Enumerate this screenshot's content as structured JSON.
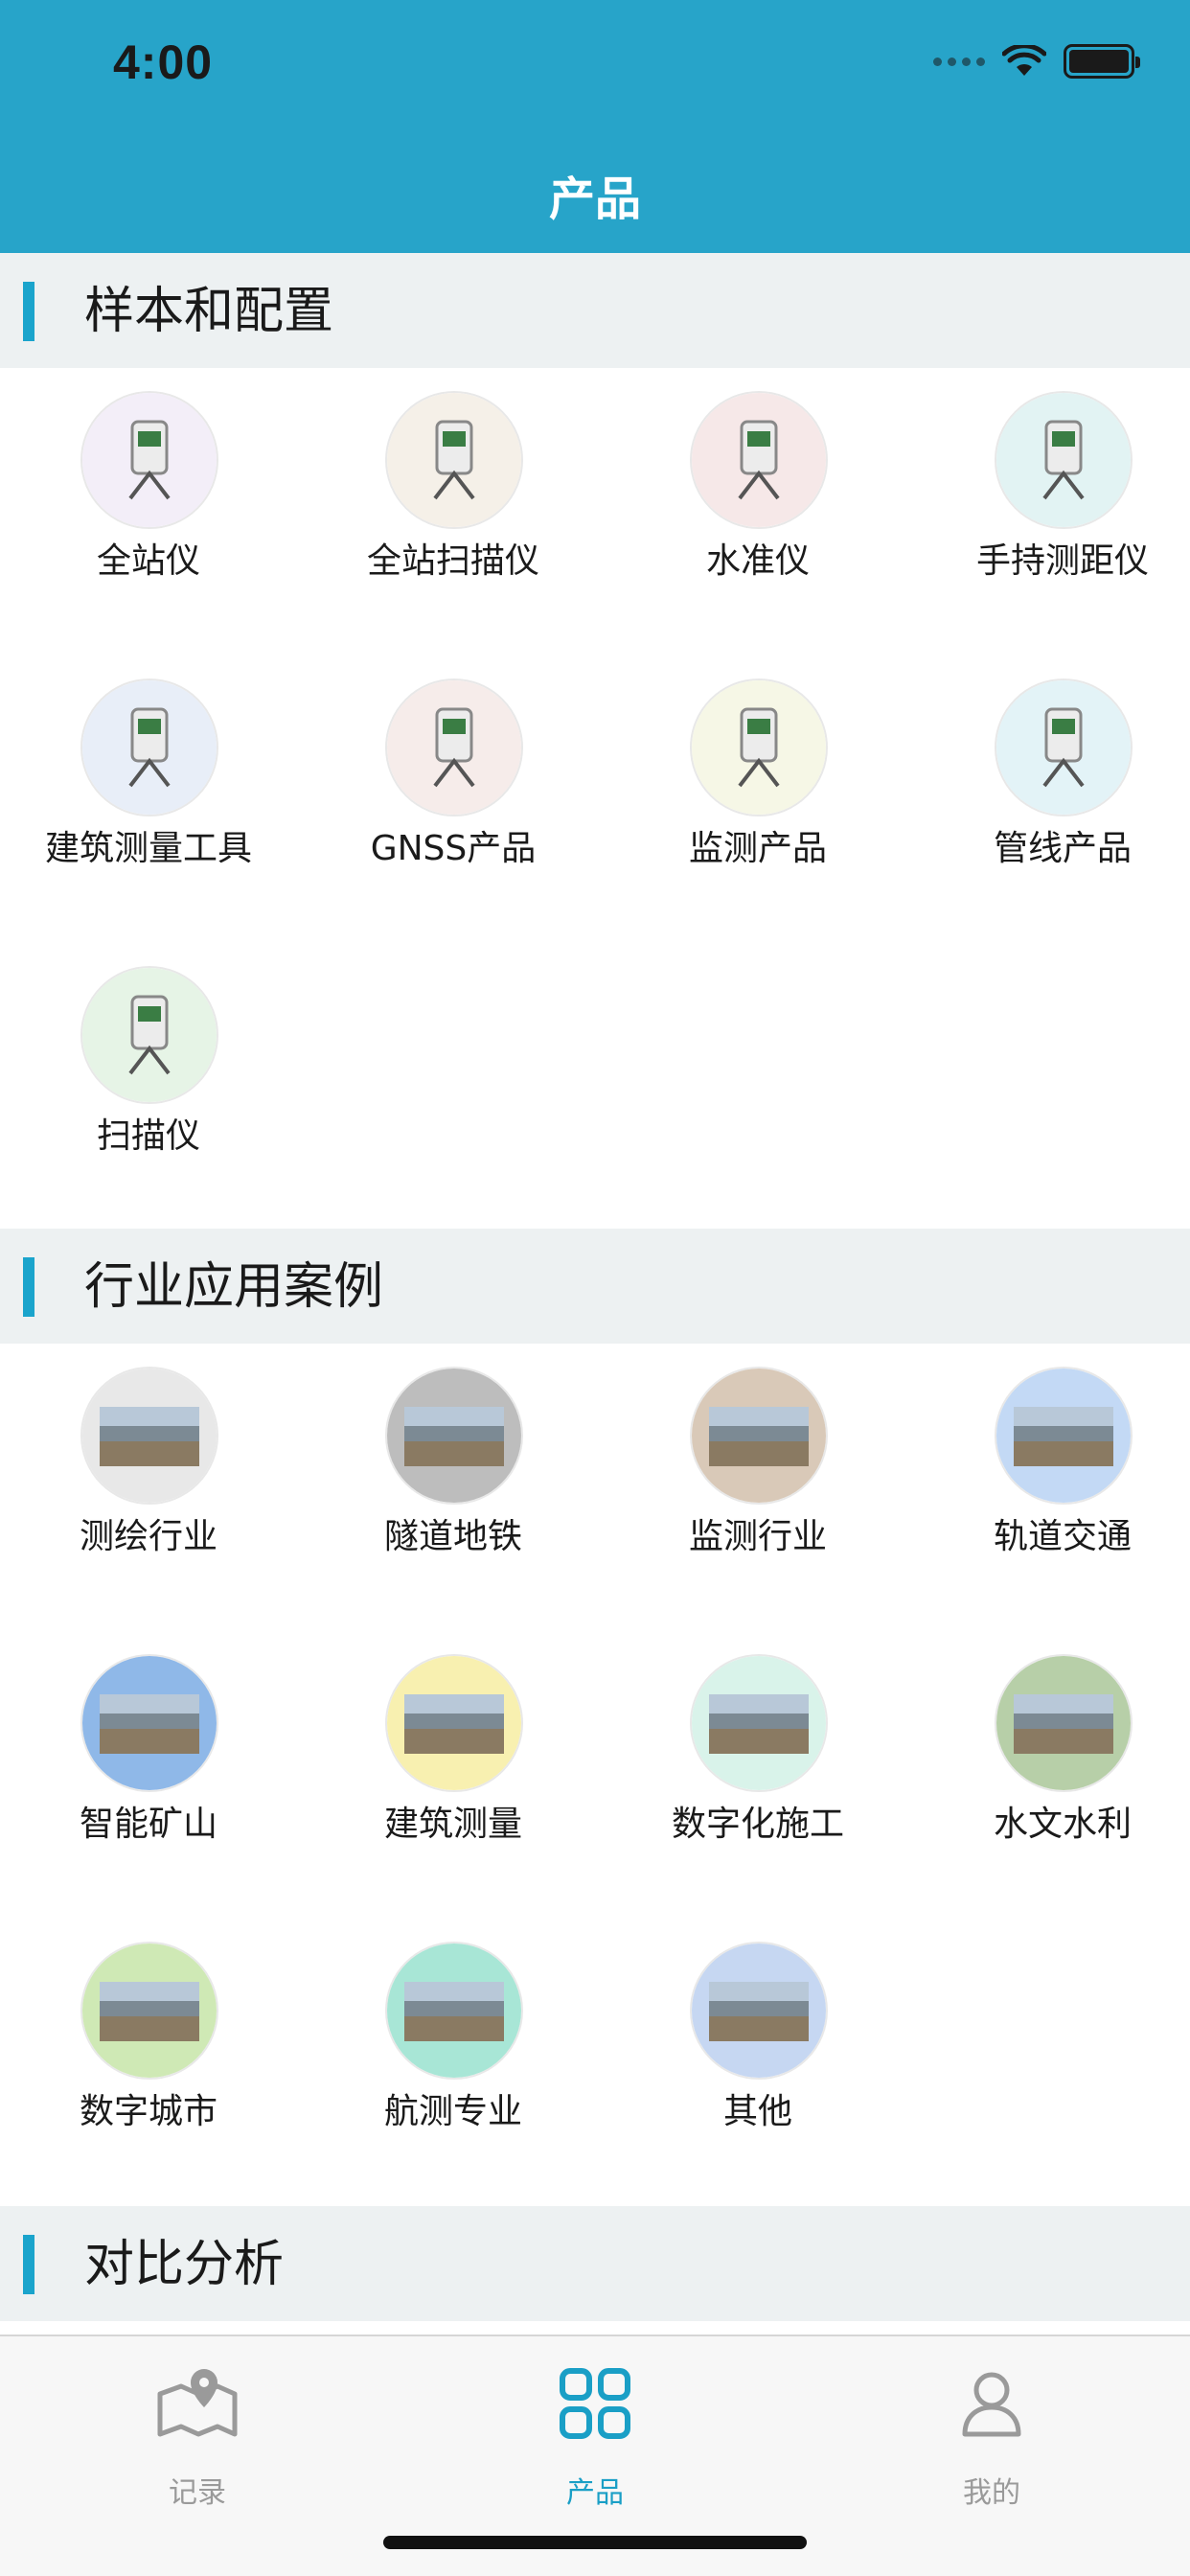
{
  "status_bar": {
    "time": "4:00"
  },
  "nav": {
    "title": "产品"
  },
  "sections": [
    {
      "title": "样本和配置",
      "items": [
        {
          "label": "全站仪",
          "icon": "total-station-icon",
          "bg": "#f3eef8"
        },
        {
          "label": "全站扫描仪",
          "icon": "scanning-total-station-icon",
          "bg": "#f5f0e8"
        },
        {
          "label": "水准仪",
          "icon": "level-instrument-icon",
          "bg": "#f6e8e8"
        },
        {
          "label": "手持测距仪",
          "icon": "handheld-rangefinder-icon",
          "bg": "#e2f3f3"
        },
        {
          "label": "建筑测量工具",
          "icon": "construction-tool-icon",
          "bg": "#e8eef8"
        },
        {
          "label": "GNSS产品",
          "icon": "gnss-icon",
          "bg": "#f6ecea"
        },
        {
          "label": "监测产品",
          "icon": "monitoring-product-icon",
          "bg": "#f6f7e6"
        },
        {
          "label": "管线产品",
          "icon": "pipeline-locator-icon",
          "bg": "#e3f3f7"
        },
        {
          "label": "扫描仪",
          "icon": "laser-scanner-icon",
          "bg": "#e6f4e6"
        }
      ]
    },
    {
      "title": "行业应用案例",
      "items": [
        {
          "label": "测绘行业",
          "icon": "surveying-industry-photo-icon",
          "bg": "#e8e8e8"
        },
        {
          "label": "隧道地铁",
          "icon": "tunnel-subway-photo-icon",
          "bg": "#bdbdbd"
        },
        {
          "label": "监测行业",
          "icon": "monitoring-industry-photo-icon",
          "bg": "#d9c9b8"
        },
        {
          "label": "轨道交通",
          "icon": "rail-transit-photo-icon",
          "bg": "#c3d9f5"
        },
        {
          "label": "智能矿山",
          "icon": "smart-mine-photo-icon",
          "bg": "#8fb8e8"
        },
        {
          "label": "建筑测量",
          "icon": "building-survey-photo-icon",
          "bg": "#f8f0b0"
        },
        {
          "label": "数字化施工",
          "icon": "digital-construction-photo-icon",
          "bg": "#d9f3ea"
        },
        {
          "label": "水文水利",
          "icon": "hydrology-photo-icon",
          "bg": "#b7cfa8"
        },
        {
          "label": "数字城市",
          "icon": "digital-city-photo-icon",
          "bg": "#cfe9b5"
        },
        {
          "label": "航测专业",
          "icon": "aerial-survey-photo-icon",
          "bg": "#a8e6d6"
        },
        {
          "label": "其他",
          "icon": "others-photo-icon",
          "bg": "#c6d7f2"
        }
      ]
    },
    {
      "title": "对比分析",
      "items": []
    }
  ],
  "tabs": [
    {
      "label": "记录",
      "icon": "map-pin-icon",
      "active": false
    },
    {
      "label": "产品",
      "icon": "grid-icon",
      "active": true
    },
    {
      "label": "我的",
      "icon": "person-icon",
      "active": false
    }
  ],
  "colors": {
    "accent": "#1a9fc6",
    "header": "#27a4c9",
    "inactive": "#9a9a9a"
  }
}
